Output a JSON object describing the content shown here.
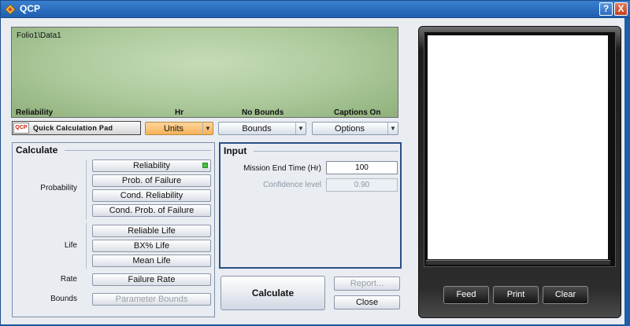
{
  "window": {
    "title": "QCP",
    "help_label": "?",
    "close_label": "X"
  },
  "display": {
    "path": "Folio1\\Data1",
    "footer": {
      "metric": "Reliability",
      "units": "Hr",
      "bounds": "No Bounds",
      "captions": "Captions On"
    }
  },
  "toolbar": {
    "logo": "QCP",
    "label": "Quick Calculation Pad",
    "units_label": "Units",
    "bounds_label": "Bounds",
    "options_label": "Options"
  },
  "calculate": {
    "heading": "Calculate",
    "probability_label": "Probability",
    "life_label": "Life",
    "rate_label": "Rate",
    "bounds_label": "Bounds",
    "buttons": {
      "reliability": "Reliability",
      "prob_failure": "Prob. of Failure",
      "cond_reliability": "Cond. Reliability",
      "cond_prob_failure": "Cond. Prob. of Failure",
      "reliable_life": "Reliable Life",
      "bx_life": "BX% Life",
      "mean_life": "Mean Life",
      "failure_rate": "Failure Rate",
      "parameter_bounds": "Parameter Bounds"
    },
    "selected_indicator_color": "#45c342"
  },
  "input": {
    "heading": "Input",
    "mission_end_label": "Mission End Time (Hr)",
    "mission_end_value": "100",
    "confidence_label": "Confidence level",
    "confidence_value": "0.90"
  },
  "actions": {
    "calculate_label": "Calculate",
    "report_label": "Report...",
    "close_label": "Close"
  },
  "printer": {
    "feed_label": "Feed",
    "print_label": "Print",
    "clear_label": "Clear"
  }
}
